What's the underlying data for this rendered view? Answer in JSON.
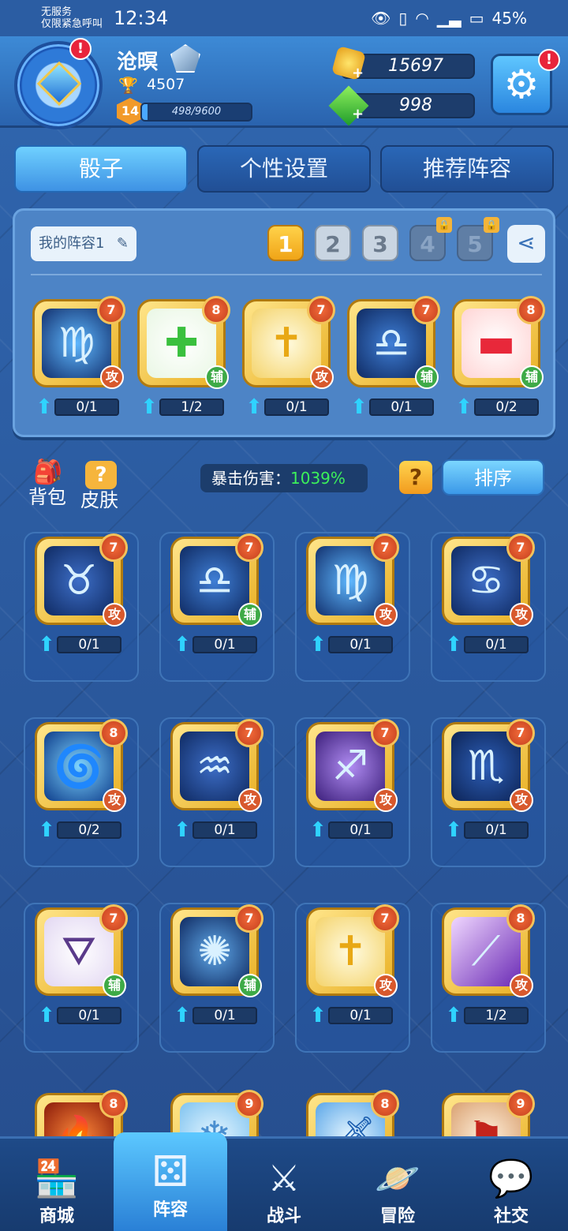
{
  "status": {
    "carrier": "无服务",
    "emergency": "仅限紧急呼叫",
    "time": "12:34",
    "battery": "45%"
  },
  "player": {
    "name": "沧暝",
    "trophies": "4507",
    "level": "14",
    "xp_text": "498/9600",
    "xp_fraction": 0.052,
    "gold": "15697",
    "gems": "998"
  },
  "tabs": [
    "骰子",
    "个性设置",
    "推荐阵容"
  ],
  "deck": {
    "name": "我的阵容1",
    "slots": [
      "1",
      "2",
      "3",
      "4",
      "5"
    ],
    "cards": [
      {
        "icon": "virgo-icon",
        "level": "7",
        "type": "攻",
        "progress": "0/1"
      },
      {
        "icon": "heal-cross-icon",
        "level": "8",
        "type": "辅",
        "progress": "1/2"
      },
      {
        "icon": "holy-cross-icon",
        "level": "7",
        "type": "攻",
        "progress": "0/1"
      },
      {
        "icon": "libra-icon",
        "level": "7",
        "type": "辅",
        "progress": "0/1"
      },
      {
        "icon": "magic-hat-icon",
        "level": "8",
        "type": "辅",
        "progress": "0/2"
      }
    ]
  },
  "toolbar": {
    "bag": "背包",
    "skin": "皮肤",
    "crit_label": "暴击伤害：",
    "crit_value": "1039%",
    "help": "?",
    "sort": "排序"
  },
  "collection": [
    {
      "icon": "taurus-icon",
      "level": "7",
      "type": "攻",
      "progress": "0/1"
    },
    {
      "icon": "libra-icon",
      "level": "7",
      "type": "辅",
      "progress": "0/1"
    },
    {
      "icon": "virgo-icon",
      "level": "7",
      "type": "攻",
      "progress": "0/1"
    },
    {
      "icon": "cancer-icon",
      "level": "7",
      "type": "攻",
      "progress": "0/1"
    },
    {
      "icon": "swirl-icon",
      "level": "8",
      "type": "攻",
      "progress": "0/2"
    },
    {
      "icon": "aquarius-icon",
      "level": "7",
      "type": "攻",
      "progress": "0/1"
    },
    {
      "icon": "sagittarius-icon",
      "level": "7",
      "type": "攻",
      "progress": "0/1"
    },
    {
      "icon": "scorpio-icon",
      "level": "7",
      "type": "攻",
      "progress": "0/1"
    },
    {
      "icon": "witch-hat-icon",
      "level": "7",
      "type": "辅",
      "progress": "0/1"
    },
    {
      "icon": "dandelion-icon",
      "level": "7",
      "type": "辅",
      "progress": "0/1"
    },
    {
      "icon": "holy-cross-icon",
      "level": "7",
      "type": "攻",
      "progress": "0/1"
    },
    {
      "icon": "purple-beam-icon",
      "level": "8",
      "type": "攻",
      "progress": "1/2"
    },
    {
      "icon": "fire-icon",
      "level": "8",
      "type": "",
      "progress": ""
    },
    {
      "icon": "ice-cross-icon",
      "level": "9",
      "type": "",
      "progress": ""
    },
    {
      "icon": "sword-icon",
      "level": "8",
      "type": "",
      "progress": ""
    },
    {
      "icon": "banner-icon",
      "level": "9",
      "type": "",
      "progress": ""
    }
  ],
  "nav": [
    {
      "label": "商城",
      "icon": "shop-icon"
    },
    {
      "label": "阵容",
      "icon": "dice-icon"
    },
    {
      "label": "战斗",
      "icon": "crossed-swords-icon"
    },
    {
      "label": "冒险",
      "icon": "planet-icon"
    },
    {
      "label": "社交",
      "icon": "chat-icon"
    }
  ]
}
